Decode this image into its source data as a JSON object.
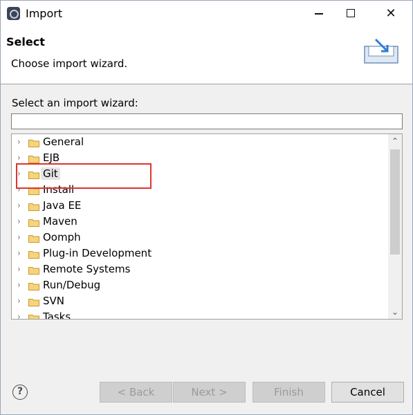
{
  "window": {
    "title": "Import",
    "minimize": "–",
    "close": "✕"
  },
  "banner": {
    "title": "Select",
    "description": "Choose import wizard."
  },
  "filter": {
    "label": "Select an import wizard:",
    "value": "",
    "placeholder": ""
  },
  "tree": {
    "items": [
      {
        "label": "General"
      },
      {
        "label": "EJB"
      },
      {
        "label": "Git"
      },
      {
        "label": "Install"
      },
      {
        "label": "Java EE"
      },
      {
        "label": "Maven"
      },
      {
        "label": "Oomph"
      },
      {
        "label": "Plug-in Development"
      },
      {
        "label": "Remote Systems"
      },
      {
        "label": "Run/Debug"
      },
      {
        "label": "SVN"
      },
      {
        "label": "Tasks"
      }
    ]
  },
  "scrollbar": {
    "up": "⌃",
    "down": "⌄"
  },
  "footer": {
    "help": "?",
    "back": "< Back",
    "next": "Next >",
    "finish": "Finish",
    "cancel": "Cancel"
  },
  "colors": {
    "highlight": "#e0332d",
    "folder": "#e8b84a"
  }
}
